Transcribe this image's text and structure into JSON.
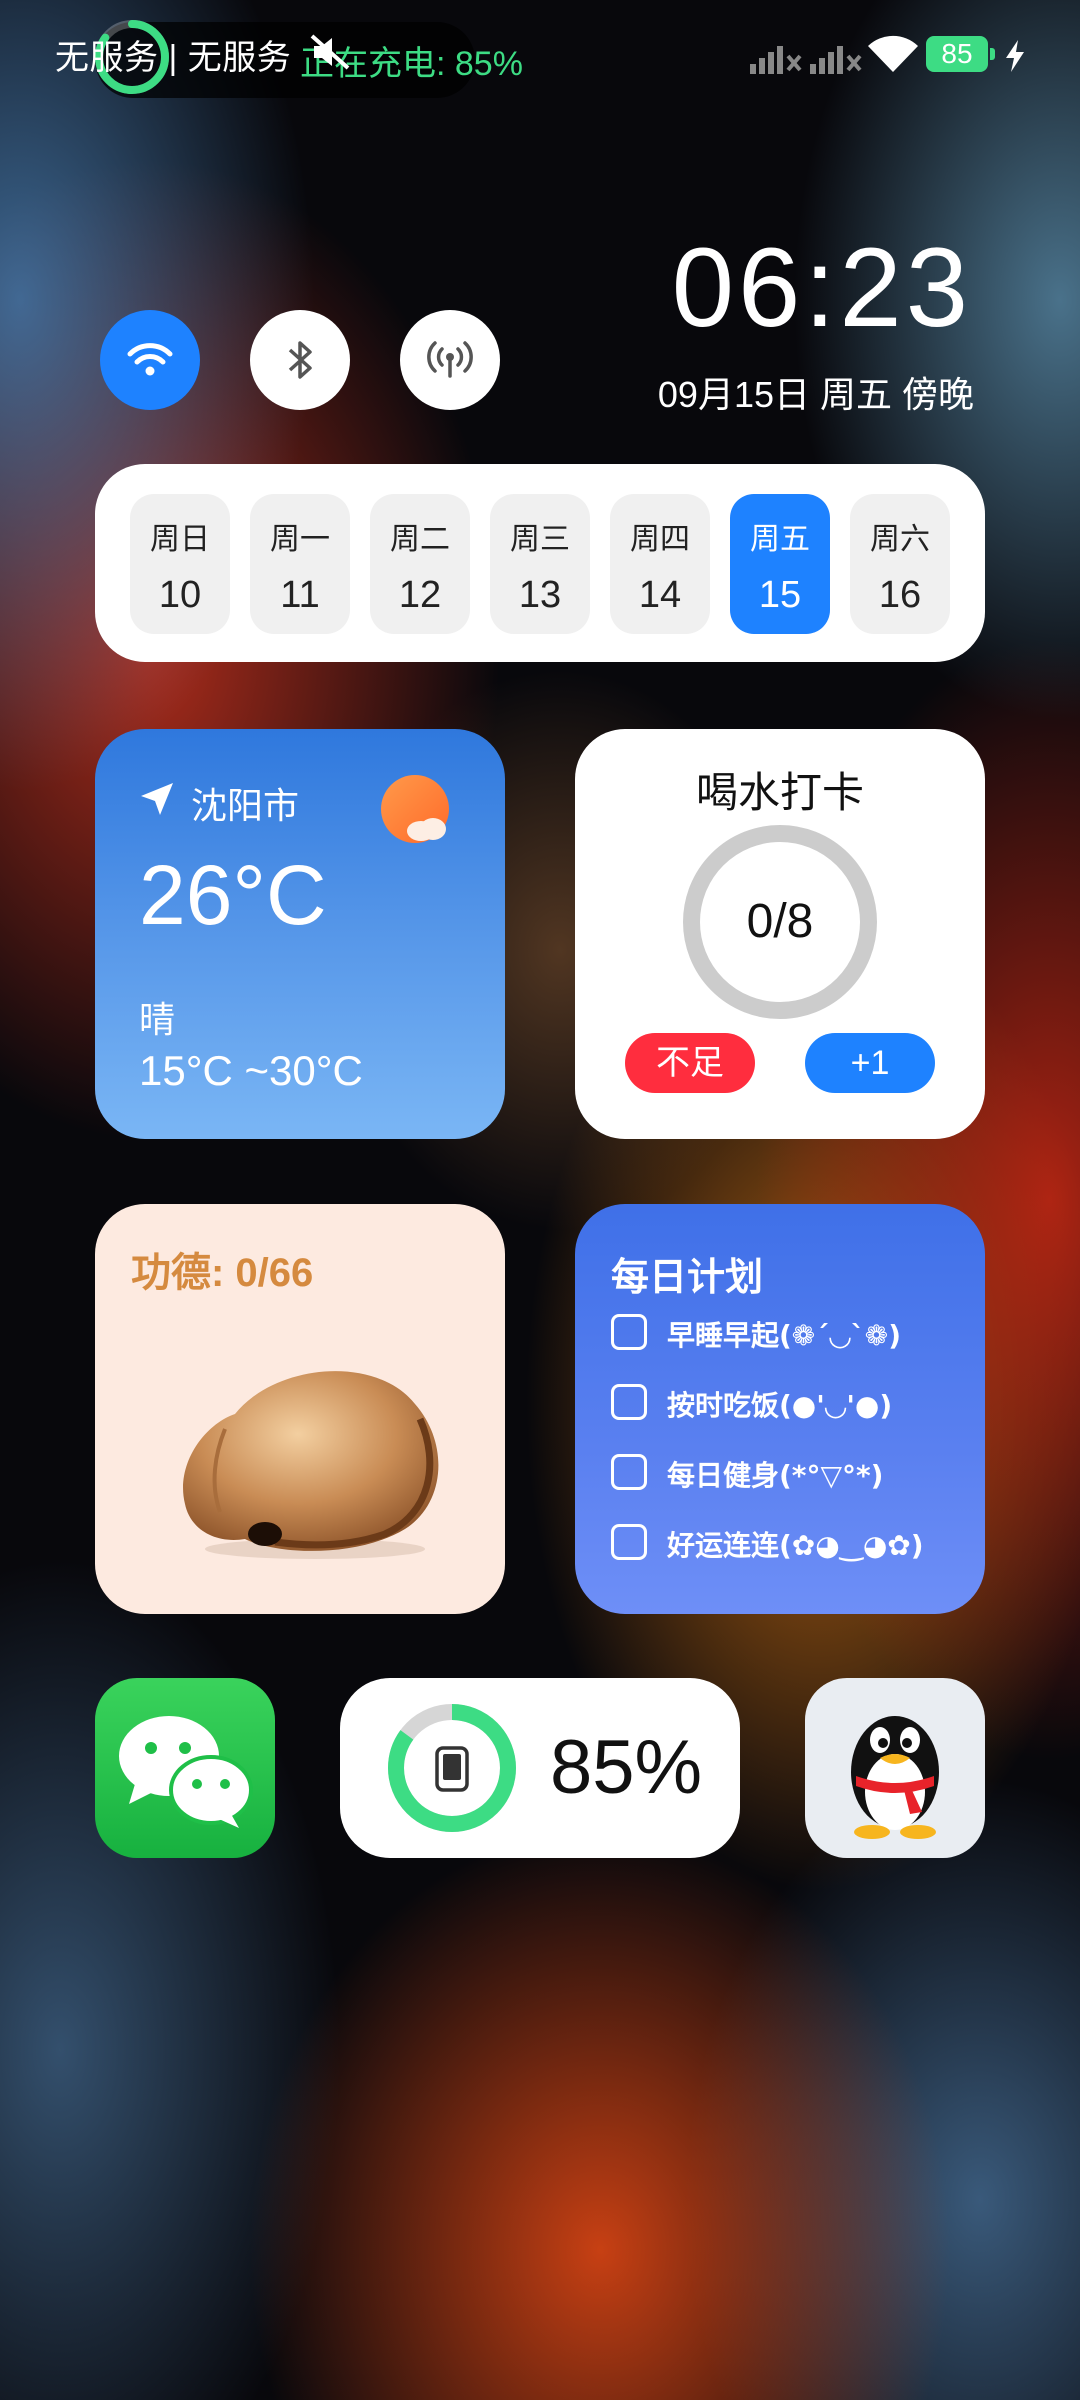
{
  "status_bar": {
    "carrier_text": "无服务 | 无服务",
    "charging_text": "正在充电: 85%",
    "battery_level": "85"
  },
  "toggles": [
    {
      "name": "wifi",
      "active": true
    },
    {
      "name": "bluetooth",
      "active": false
    },
    {
      "name": "hotspot",
      "active": false
    }
  ],
  "clock": {
    "time": "06:23",
    "date": "09月15日 周五 傍晚"
  },
  "week": [
    {
      "day": "周日",
      "date": "10"
    },
    {
      "day": "周一",
      "date": "11"
    },
    {
      "day": "周二",
      "date": "12"
    },
    {
      "day": "周三",
      "date": "13"
    },
    {
      "day": "周四",
      "date": "14"
    },
    {
      "day": "周五",
      "date": "15",
      "selected": true
    },
    {
      "day": "周六",
      "date": "16"
    }
  ],
  "weather": {
    "city": "沈阳市",
    "temperature": "26°C",
    "condition": "晴",
    "range": "15°C ~30°C",
    "icon": "sun-cloud-icon"
  },
  "water": {
    "title": "喝水打卡",
    "count": "0/8",
    "progress": 0,
    "status_label": "不足",
    "add_label": "+1"
  },
  "merit": {
    "label": "功德: 0/66",
    "icon": "wooden-fish-icon"
  },
  "plan": {
    "title": "每日计划",
    "items": [
      {
        "text": "早睡早起(❁´◡`❁)",
        "checked": false
      },
      {
        "text": "按时吃饭(●'◡'●)",
        "checked": false
      },
      {
        "text": "每日健身(*°▽°*)",
        "checked": false
      },
      {
        "text": "好运连连(✿◕‿◕✿)",
        "checked": false
      }
    ]
  },
  "apps": [
    {
      "name": "WeChat",
      "icon": "wechat-icon"
    },
    {
      "name": "QQ",
      "icon": "qq-penguin-icon"
    }
  ],
  "battery_widget": {
    "percent": "85%",
    "level": 0.85
  },
  "colors": {
    "accent_blue": "#1e82ff",
    "alert_red": "#ff2d3e",
    "battery_green": "#3ddc84",
    "merit_text": "#d58a3f"
  }
}
